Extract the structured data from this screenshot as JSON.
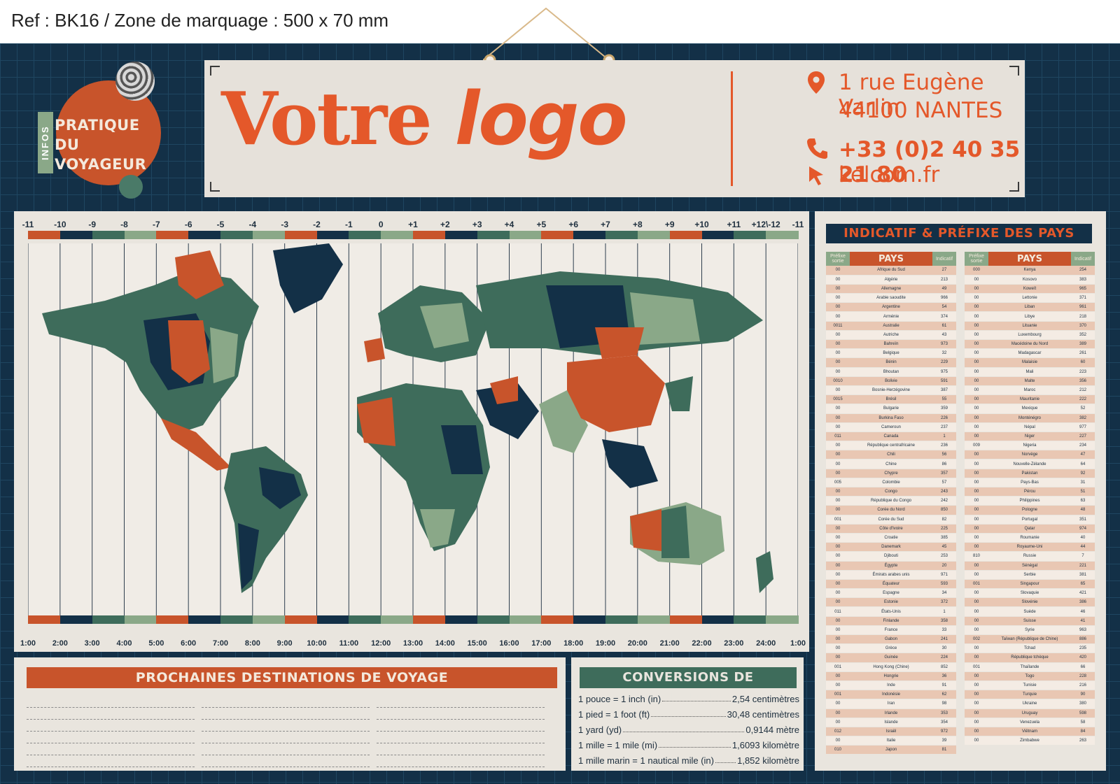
{
  "ref": "Ref : BK16 / Zone de marquage : 500 x 70 mm",
  "badge": {
    "side": "INFOS",
    "line1": "PRATIQUE DU",
    "line2": "VOYAGEUR"
  },
  "logo": {
    "part1": "Votre",
    "part2": "logo",
    "address_line1": "1 rue Eugène Varlin",
    "address_line2": "44100 NANTES",
    "phone": "+33 (0)2 40 35 21 80",
    "website": "kelcom.fr",
    "icons": [
      "location-pin-icon",
      "phone-icon",
      "cursor-icon"
    ]
  },
  "map": {
    "timezones": [
      "-11",
      "-10",
      "-9",
      "-8",
      "-7",
      "-6",
      "-5",
      "-4",
      "-3",
      "-2",
      "-1",
      "0",
      "+1",
      "+2",
      "+3",
      "+4",
      "+5",
      "+6",
      "+7",
      "+8",
      "+9",
      "+10",
      "+11",
      "+12\\-12",
      "-11"
    ],
    "hours": [
      "1:00",
      "2:00",
      "3:00",
      "4:00",
      "5:00",
      "6:00",
      "7:00",
      "8:00",
      "9:00",
      "10:00",
      "11:00",
      "12:00",
      "13:00",
      "14:00",
      "15:00",
      "16:00",
      "17:00",
      "18:00",
      "19:00",
      "20:00",
      "21:00",
      "22:00",
      "23:00",
      "24:00",
      "1:00"
    ],
    "colors": {
      "navy": "#133047",
      "green": "#3e6c5b",
      "sage": "#8aa888",
      "orange": "#c8542b",
      "cream": "#e9e5de"
    }
  },
  "destinations": {
    "title": "PROCHAINES DESTINATIONS DE VOYAGE"
  },
  "conversions": {
    "title": "CONVERSIONS DE LONGUEURS",
    "rows": [
      {
        "left": "1 pouce = 1 inch (in)",
        "right": "2,54 centimètres"
      },
      {
        "left": "1 pied = 1 foot (ft)",
        "right": "30,48 centimètres"
      },
      {
        "left": "1 yard  (yd)",
        "right": "0,9144  mètre"
      },
      {
        "left": "1 mille = 1 mile (mi)",
        "right": "1,6093 kilomètre"
      },
      {
        "left": "1 mille marin = 1 nautical mile (in)",
        "right": "1,852 kilomètre"
      }
    ]
  },
  "codes": {
    "title": "INDICATIF & PRÉFIXE DES PAYS",
    "head_prefix": "Préfixe sortie",
    "head_country": "PAYS",
    "head_code": "Indicatif",
    "left": [
      [
        "00",
        "Afrique du Sud",
        "27"
      ],
      [
        "00",
        "Algérie",
        "213"
      ],
      [
        "00",
        "Allemagne",
        "49"
      ],
      [
        "00",
        "Arabie saoudite",
        "966"
      ],
      [
        "00",
        "Argentine",
        "54"
      ],
      [
        "00",
        "Arménie",
        "374"
      ],
      [
        "0011",
        "Australie",
        "61"
      ],
      [
        "00",
        "Autriche",
        "43"
      ],
      [
        "00",
        "Bahreïn",
        "973"
      ],
      [
        "00",
        "Belgique",
        "32"
      ],
      [
        "00",
        "Bénin",
        "229"
      ],
      [
        "00",
        "Bhoutan",
        "975"
      ],
      [
        "0010",
        "Bolivie",
        "591"
      ],
      [
        "00",
        "Bosnie-Herzégovine",
        "387"
      ],
      [
        "0015",
        "Brésil",
        "55"
      ],
      [
        "00",
        "Bulgarie",
        "359"
      ],
      [
        "00",
        "Burkina Faso",
        "226"
      ],
      [
        "00",
        "Cameroun",
        "237"
      ],
      [
        "011",
        "Canada",
        "1"
      ],
      [
        "00",
        "République centrafricaine",
        "236"
      ],
      [
        "00",
        "Chili",
        "56"
      ],
      [
        "00",
        "Chine",
        "86"
      ],
      [
        "00",
        "Chypre",
        "357"
      ],
      [
        "005",
        "Colombie",
        "57"
      ],
      [
        "00",
        "Congo",
        "243"
      ],
      [
        "00",
        "République du Congo",
        "242"
      ],
      [
        "00",
        "Corée du Nord",
        "850"
      ],
      [
        "001",
        "Corée du Sud",
        "82"
      ],
      [
        "00",
        "Côte d'Ivoire",
        "225"
      ],
      [
        "00",
        "Croatie",
        "385"
      ],
      [
        "00",
        "Danemark",
        "45"
      ],
      [
        "00",
        "Djibouti",
        "253"
      ],
      [
        "00",
        "Égypte",
        "20"
      ],
      [
        "00",
        "Émirats arabes unis",
        "971"
      ],
      [
        "00",
        "Équateur",
        "593"
      ],
      [
        "00",
        "Espagne",
        "34"
      ],
      [
        "00",
        "Estonie",
        "372"
      ],
      [
        "011",
        "États-Unis",
        "1"
      ],
      [
        "00",
        "Finlande",
        "358"
      ],
      [
        "00",
        "France",
        "33"
      ],
      [
        "00",
        "Gabon",
        "241"
      ],
      [
        "00",
        "Grèce",
        "30"
      ],
      [
        "00",
        "Guinée",
        "224"
      ],
      [
        "001",
        "Hong Kong (Chine)",
        "852"
      ],
      [
        "00",
        "Hongrie",
        "36"
      ],
      [
        "00",
        "Inde",
        "91"
      ],
      [
        "001",
        "Indonésie",
        "62"
      ],
      [
        "00",
        "Iran",
        "98"
      ],
      [
        "00",
        "Irlande",
        "353"
      ],
      [
        "00",
        "Islande",
        "354"
      ],
      [
        "012",
        "Israël",
        "972"
      ],
      [
        "00",
        "Italie",
        "39"
      ],
      [
        "010",
        "Japon",
        "81"
      ]
    ],
    "right": [
      [
        "000",
        "Kenya",
        "254"
      ],
      [
        "00",
        "Kosovo",
        "383"
      ],
      [
        "00",
        "Koweït",
        "965"
      ],
      [
        "00",
        "Lettonie",
        "371"
      ],
      [
        "00",
        "Liban",
        "961"
      ],
      [
        "00",
        "Libye",
        "218"
      ],
      [
        "00",
        "Lituanie",
        "370"
      ],
      [
        "00",
        "Luxembourg",
        "352"
      ],
      [
        "00",
        "Macédoine du Nord",
        "389"
      ],
      [
        "00",
        "Madagascar",
        "261"
      ],
      [
        "00",
        "Malaisie",
        "60"
      ],
      [
        "00",
        "Mali",
        "223"
      ],
      [
        "00",
        "Malte",
        "356"
      ],
      [
        "00",
        "Maroc",
        "212"
      ],
      [
        "00",
        "Mauritanie",
        "222"
      ],
      [
        "00",
        "Mexique",
        "52"
      ],
      [
        "00",
        "Monténégro",
        "382"
      ],
      [
        "00",
        "Népal",
        "977"
      ],
      [
        "00",
        "Niger",
        "227"
      ],
      [
        "009",
        "Nigeria",
        "234"
      ],
      [
        "00",
        "Norvège",
        "47"
      ],
      [
        "00",
        "Nouvelle-Zélande",
        "64"
      ],
      [
        "00",
        "Pakistan",
        "92"
      ],
      [
        "00",
        "Pays-Bas",
        "31"
      ],
      [
        "00",
        "Pérou",
        "51"
      ],
      [
        "00",
        "Philippines",
        "63"
      ],
      [
        "00",
        "Pologne",
        "48"
      ],
      [
        "00",
        "Portugal",
        "351"
      ],
      [
        "00",
        "Qatar",
        "974"
      ],
      [
        "00",
        "Roumanie",
        "40"
      ],
      [
        "00",
        "Royaume-Uni",
        "44"
      ],
      [
        "810",
        "Russie",
        "7"
      ],
      [
        "00",
        "Sénégal",
        "221"
      ],
      [
        "00",
        "Serbie",
        "381"
      ],
      [
        "001",
        "Singapour",
        "65"
      ],
      [
        "00",
        "Slovaquie",
        "421"
      ],
      [
        "00",
        "Slovénie",
        "386"
      ],
      [
        "00",
        "Suède",
        "46"
      ],
      [
        "00",
        "Suisse",
        "41"
      ],
      [
        "00",
        "Syrie",
        "963"
      ],
      [
        "002",
        "Taïwan (République de Chine)",
        "886"
      ],
      [
        "00",
        "Tchad",
        "235"
      ],
      [
        "00",
        "République tchèque",
        "420"
      ],
      [
        "001",
        "Thaïlande",
        "66"
      ],
      [
        "00",
        "Togo",
        "228"
      ],
      [
        "00",
        "Tunisie",
        "216"
      ],
      [
        "00",
        "Turquie",
        "90"
      ],
      [
        "00",
        "Ukraine",
        "380"
      ],
      [
        "00",
        "Uruguay",
        "598"
      ],
      [
        "00",
        "Venezuela",
        "58"
      ],
      [
        "00",
        "Viêtnam",
        "84"
      ],
      [
        "00",
        "Zimbabwe",
        "263"
      ]
    ]
  }
}
